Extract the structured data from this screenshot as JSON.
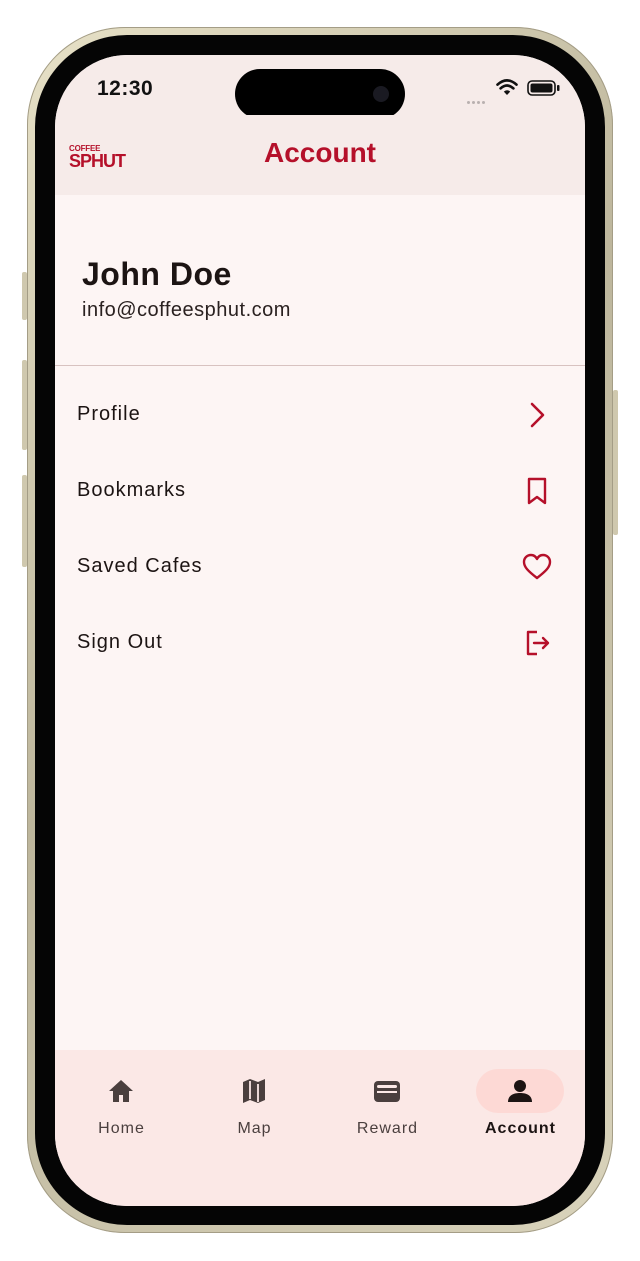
{
  "status_bar": {
    "time": "12:30"
  },
  "app_bar": {
    "logo_top": "COFFEE",
    "logo_bottom": "SPHUT",
    "title": "Account"
  },
  "profile": {
    "name": "John Doe",
    "email": "info@coffeesphut.com"
  },
  "menu": {
    "items": [
      {
        "label": "Profile",
        "icon": "chevron-right-icon"
      },
      {
        "label": "Bookmarks",
        "icon": "bookmark-icon"
      },
      {
        "label": "Saved Cafes",
        "icon": "heart-icon"
      },
      {
        "label": "Sign Out",
        "icon": "logout-icon"
      }
    ]
  },
  "bottom_nav": {
    "items": [
      {
        "label": "Home",
        "icon": "home-icon",
        "active": false
      },
      {
        "label": "Map",
        "icon": "map-icon",
        "active": false
      },
      {
        "label": "Reward",
        "icon": "wallet-icon",
        "active": false
      },
      {
        "label": "Account",
        "icon": "person-icon",
        "active": true
      }
    ]
  },
  "colors": {
    "brand_red": "#b5102a",
    "background": "#fdf5f4",
    "app_bar_bg": "#f6ebe9",
    "nav_bg": "#fbe8e6",
    "active_pill": "#fdd9d5"
  }
}
